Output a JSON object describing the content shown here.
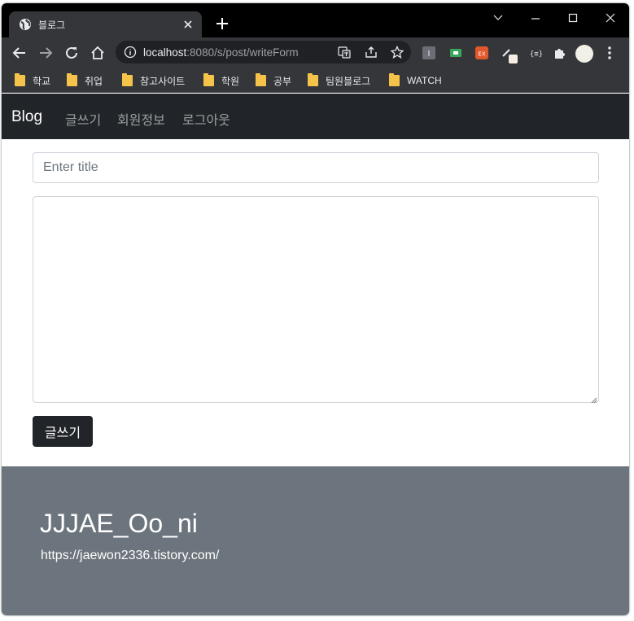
{
  "browser": {
    "tab_title": "블로그",
    "url_host": "localhost",
    "url_rest": ":8080/s/post/writeForm",
    "bookmarks": [
      "학교",
      "취업",
      "참고사이트",
      "학원",
      "공부",
      "팀원블로그",
      "WATCH"
    ],
    "ext_badge": "EX",
    "ext_code": "{≡}",
    "ext_letter": "I"
  },
  "site": {
    "brand": "Blog",
    "nav": [
      "글쓰기",
      "회원정보",
      "로그아웃"
    ]
  },
  "form": {
    "title_placeholder": "Enter title",
    "title_value": "",
    "content_value": "",
    "submit_label": "글쓰기"
  },
  "footer": {
    "title": "JJJAE_Oo_ni",
    "link": "https://jaewon2336.tistory.com/"
  },
  "colors": {
    "navbar": "#212529",
    "footer": "#6c757d",
    "button": "#212529",
    "tab_active": "#35363a",
    "tab_strip": "#000000"
  }
}
